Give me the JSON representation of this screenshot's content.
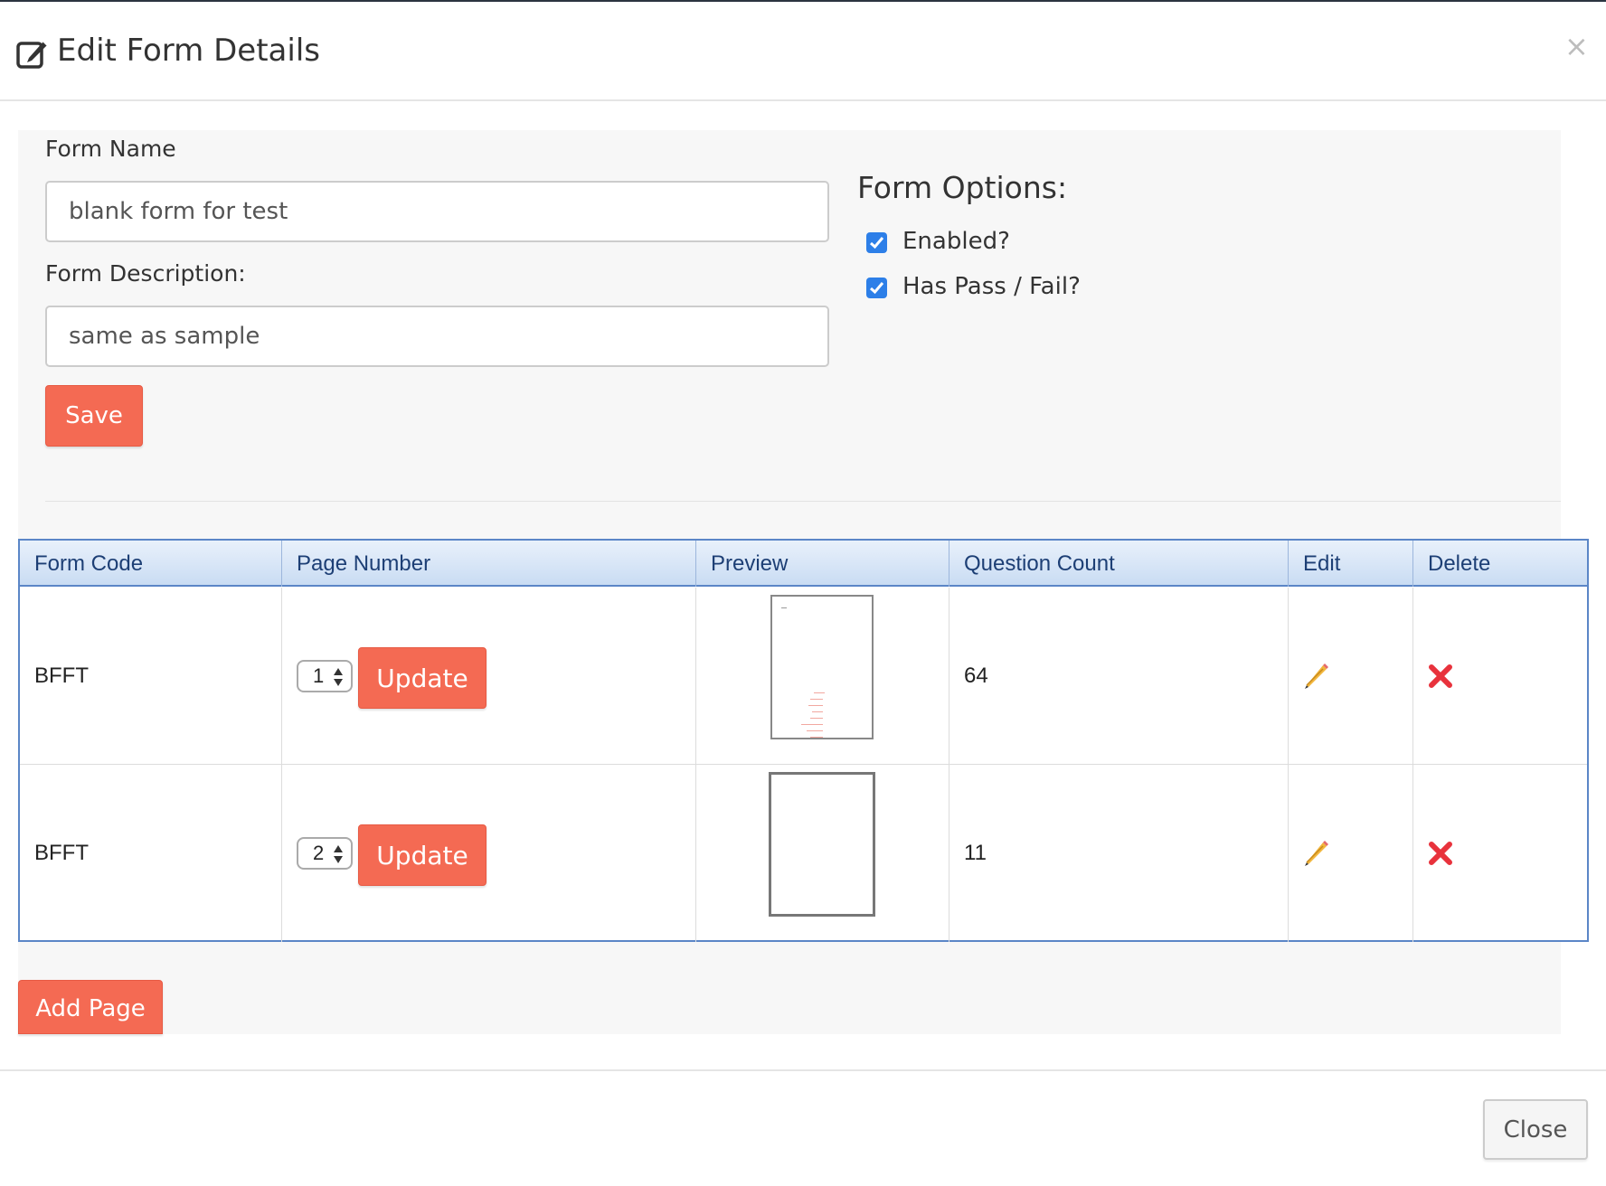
{
  "modal": {
    "title": "Edit Form Details",
    "close_symbol": "×",
    "title_icon": "edit-square-icon"
  },
  "form": {
    "name_label": "Form Name",
    "name_value": "blank form for test",
    "description_label": "Form Description:",
    "description_value": "same as sample",
    "save_label": "Save"
  },
  "options": {
    "title": "Form Options:",
    "items": [
      {
        "label": "Enabled?",
        "checked": true
      },
      {
        "label": "Has Pass / Fail?",
        "checked": true
      }
    ]
  },
  "table": {
    "headers": [
      "Form Code",
      "Page Number",
      "Preview",
      "Question Count",
      "Edit",
      "Delete"
    ],
    "rows": [
      {
        "form_code": "BFFT",
        "page_number": "1",
        "update_label": "Update",
        "question_count": "64"
      },
      {
        "form_code": "BFFT",
        "page_number": "2",
        "update_label": "Update",
        "question_count": "11"
      }
    ]
  },
  "add_page_label": "Add Page",
  "footer": {
    "close_label": "Close"
  },
  "colors": {
    "accent_red": "#f46a53",
    "checkbox_blue": "#2d7fe8",
    "table_header_text": "#1d3f75",
    "table_border": "#5b86c7"
  }
}
